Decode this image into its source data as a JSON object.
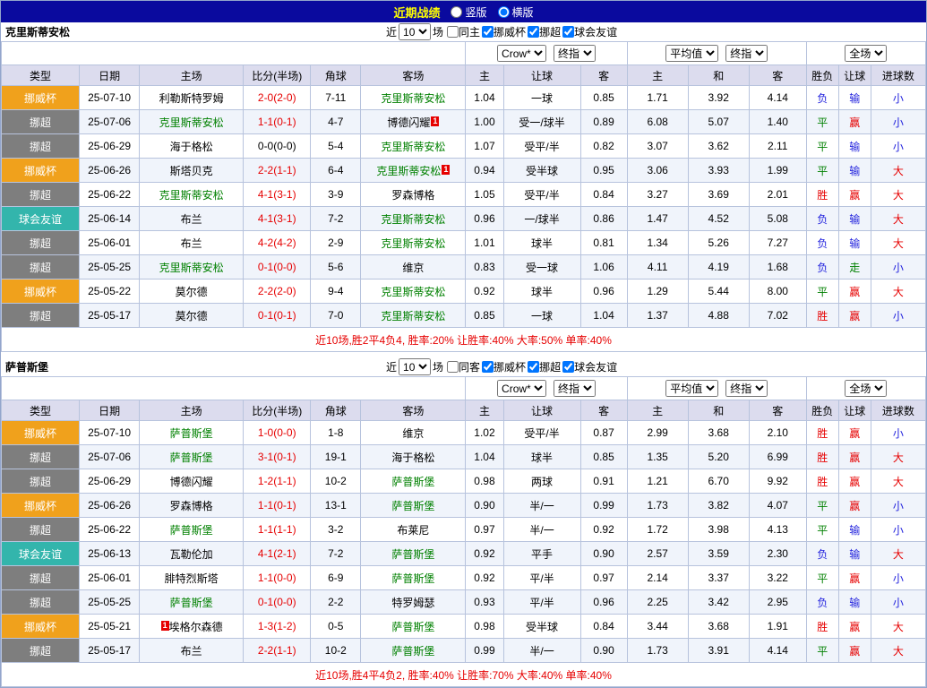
{
  "topbar": {
    "title": "近期战绩",
    "layout_options": [
      {
        "label": "竖版",
        "checked": false
      },
      {
        "label": "横版",
        "checked": true
      }
    ]
  },
  "colors": {
    "topbar_bg": "#0a0a9e",
    "title_color": "#ffff00",
    "header_bg": "#dcdcee",
    "type_bg": {
      "挪超": "#7e7e7e",
      "挪威杯": "#f0a11c",
      "球会友谊": "#33b5ac"
    },
    "result": {
      "胜": "#e60000",
      "平": "#008000",
      "负": "#2222dd",
      "赢": "#e60000",
      "输": "#2222dd",
      "走": "#008000",
      "大": "#e60000",
      "小": "#2222dd"
    },
    "team_highlight": "#008000",
    "score": "#e60000",
    "summary": "#e60000"
  },
  "table_columns": [
    "类型",
    "日期",
    "主场",
    "比分(半场)",
    "角球",
    "客场",
    "主",
    "让球",
    "客",
    "主",
    "和",
    "客",
    "胜负",
    "让球",
    "进球数"
  ],
  "sections": [
    {
      "team": "克里斯蒂安松",
      "range": {
        "prefix": "近",
        "count": "10",
        "suffix": "场"
      },
      "filters": [
        {
          "label": "同主",
          "checked": false
        },
        {
          "label": "挪威杯",
          "checked": true
        },
        {
          "label": "挪超",
          "checked": true
        },
        {
          "label": "球会友谊",
          "checked": true
        }
      ],
      "header_selects": {
        "asia": [
          "Crow*",
          "终指"
        ],
        "europe": [
          "平均值",
          "终指"
        ],
        "scope": [
          "全场"
        ]
      },
      "rows": [
        {
          "type": "挪威杯",
          "date": "25-07-10",
          "home": {
            "name": "利勒斯特罗姆"
          },
          "score": {
            "text": "2-0(2-0)",
            "red": true
          },
          "corner": "7-11",
          "away": {
            "name": "克里斯蒂安松",
            "green": true
          },
          "asia": [
            "1.04",
            "一球",
            "0.85"
          ],
          "europe": [
            "1.71",
            "3.92",
            "4.14"
          ],
          "result": [
            "负",
            "输",
            "小"
          ]
        },
        {
          "type": "挪超",
          "date": "25-07-06",
          "home": {
            "name": "克里斯蒂安松",
            "green": true
          },
          "score": {
            "text": "1-1(0-1)",
            "red": true
          },
          "corner": "4-7",
          "away": {
            "name": "博德闪耀",
            "badge": "1"
          },
          "asia": [
            "1.00",
            "受一/球半",
            "0.89"
          ],
          "europe": [
            "6.08",
            "5.07",
            "1.40"
          ],
          "result": [
            "平",
            "赢",
            "小"
          ]
        },
        {
          "type": "挪超",
          "date": "25-06-29",
          "home": {
            "name": "海于格松"
          },
          "score": {
            "text": "0-0(0-0)",
            "red": false
          },
          "corner": "5-4",
          "away": {
            "name": "克里斯蒂安松",
            "green": true
          },
          "asia": [
            "1.07",
            "受平/半",
            "0.82"
          ],
          "europe": [
            "3.07",
            "3.62",
            "2.11"
          ],
          "result": [
            "平",
            "输",
            "小"
          ]
        },
        {
          "type": "挪威杯",
          "date": "25-06-26",
          "home": {
            "name": "斯塔贝克"
          },
          "score": {
            "text": "2-2(1-1)",
            "red": true
          },
          "corner": "6-4",
          "away": {
            "name": "克里斯蒂安松",
            "green": true,
            "badge": "1"
          },
          "asia": [
            "0.94",
            "受半球",
            "0.95"
          ],
          "europe": [
            "3.06",
            "3.93",
            "1.99"
          ],
          "result": [
            "平",
            "输",
            "大"
          ]
        },
        {
          "type": "挪超",
          "date": "25-06-22",
          "home": {
            "name": "克里斯蒂安松",
            "green": true
          },
          "score": {
            "text": "4-1(3-1)",
            "red": true
          },
          "corner": "3-9",
          "away": {
            "name": "罗森博格"
          },
          "asia": [
            "1.05",
            "受平/半",
            "0.84"
          ],
          "europe": [
            "3.27",
            "3.69",
            "2.01"
          ],
          "result": [
            "胜",
            "赢",
            "大"
          ]
        },
        {
          "type": "球会友谊",
          "date": "25-06-14",
          "home": {
            "name": "布兰"
          },
          "score": {
            "text": "4-1(3-1)",
            "red": true
          },
          "corner": "7-2",
          "away": {
            "name": "克里斯蒂安松",
            "green": true
          },
          "asia": [
            "0.96",
            "一/球半",
            "0.86"
          ],
          "europe": [
            "1.47",
            "4.52",
            "5.08"
          ],
          "result": [
            "负",
            "输",
            "大"
          ]
        },
        {
          "type": "挪超",
          "date": "25-06-01",
          "home": {
            "name": "布兰"
          },
          "score": {
            "text": "4-2(4-2)",
            "red": true
          },
          "corner": "2-9",
          "away": {
            "name": "克里斯蒂安松",
            "green": true
          },
          "asia": [
            "1.01",
            "球半",
            "0.81"
          ],
          "europe": [
            "1.34",
            "5.26",
            "7.27"
          ],
          "result": [
            "负",
            "输",
            "大"
          ]
        },
        {
          "type": "挪超",
          "date": "25-05-25",
          "home": {
            "name": "克里斯蒂安松",
            "green": true
          },
          "score": {
            "text": "0-1(0-0)",
            "red": true
          },
          "corner": "5-6",
          "away": {
            "name": "维京"
          },
          "asia": [
            "0.83",
            "受一球",
            "1.06"
          ],
          "europe": [
            "4.11",
            "4.19",
            "1.68"
          ],
          "result": [
            "负",
            "走",
            "小"
          ]
        },
        {
          "type": "挪威杯",
          "date": "25-05-22",
          "home": {
            "name": "莫尔德"
          },
          "score": {
            "text": "2-2(2-0)",
            "red": true
          },
          "corner": "9-4",
          "away": {
            "name": "克里斯蒂安松",
            "green": true
          },
          "asia": [
            "0.92",
            "球半",
            "0.96"
          ],
          "europe": [
            "1.29",
            "5.44",
            "8.00"
          ],
          "result": [
            "平",
            "赢",
            "大"
          ]
        },
        {
          "type": "挪超",
          "date": "25-05-17",
          "home": {
            "name": "莫尔德"
          },
          "score": {
            "text": "0-1(0-1)",
            "red": true
          },
          "corner": "7-0",
          "away": {
            "name": "克里斯蒂安松",
            "green": true
          },
          "asia": [
            "0.85",
            "一球",
            "1.04"
          ],
          "europe": [
            "1.37",
            "4.88",
            "7.02"
          ],
          "result": [
            "胜",
            "赢",
            "小"
          ]
        }
      ],
      "summary": "近10场,胜2平4负4, 胜率:20% 让胜率:40% 大率:50% 单率:40%"
    },
    {
      "team": "萨普斯堡",
      "range": {
        "prefix": "近",
        "count": "10",
        "suffix": "场"
      },
      "filters": [
        {
          "label": "同客",
          "checked": false
        },
        {
          "label": "挪威杯",
          "checked": true
        },
        {
          "label": "挪超",
          "checked": true
        },
        {
          "label": "球会友谊",
          "checked": true
        }
      ],
      "header_selects": {
        "asia": [
          "Crow*",
          "终指"
        ],
        "europe": [
          "平均值",
          "终指"
        ],
        "scope": [
          "全场"
        ]
      },
      "rows": [
        {
          "type": "挪威杯",
          "date": "25-07-10",
          "home": {
            "name": "萨普斯堡",
            "green": true
          },
          "score": {
            "text": "1-0(0-0)",
            "red": true
          },
          "corner": "1-8",
          "away": {
            "name": "维京"
          },
          "asia": [
            "1.02",
            "受平/半",
            "0.87"
          ],
          "europe": [
            "2.99",
            "3.68",
            "2.10"
          ],
          "result": [
            "胜",
            "赢",
            "小"
          ]
        },
        {
          "type": "挪超",
          "date": "25-07-06",
          "home": {
            "name": "萨普斯堡",
            "green": true
          },
          "score": {
            "text": "3-1(0-1)",
            "red": true
          },
          "corner": "19-1",
          "away": {
            "name": "海于格松"
          },
          "asia": [
            "1.04",
            "球半",
            "0.85"
          ],
          "europe": [
            "1.35",
            "5.20",
            "6.99"
          ],
          "result": [
            "胜",
            "赢",
            "大"
          ]
        },
        {
          "type": "挪超",
          "date": "25-06-29",
          "home": {
            "name": "博德闪耀"
          },
          "score": {
            "text": "1-2(1-1)",
            "red": true
          },
          "corner": "10-2",
          "away": {
            "name": "萨普斯堡",
            "green": true
          },
          "asia": [
            "0.98",
            "两球",
            "0.91"
          ],
          "europe": [
            "1.21",
            "6.70",
            "9.92"
          ],
          "result": [
            "胜",
            "赢",
            "大"
          ]
        },
        {
          "type": "挪威杯",
          "date": "25-06-26",
          "home": {
            "name": "罗森博格"
          },
          "score": {
            "text": "1-1(0-1)",
            "red": true
          },
          "corner": "13-1",
          "away": {
            "name": "萨普斯堡",
            "green": true
          },
          "asia": [
            "0.90",
            "半/一",
            "0.99"
          ],
          "europe": [
            "1.73",
            "3.82",
            "4.07"
          ],
          "result": [
            "平",
            "赢",
            "小"
          ]
        },
        {
          "type": "挪超",
          "date": "25-06-22",
          "home": {
            "name": "萨普斯堡",
            "green": true
          },
          "score": {
            "text": "1-1(1-1)",
            "red": true
          },
          "corner": "3-2",
          "away": {
            "name": "布莱尼"
          },
          "asia": [
            "0.97",
            "半/一",
            "0.92"
          ],
          "europe": [
            "1.72",
            "3.98",
            "4.13"
          ],
          "result": [
            "平",
            "输",
            "小"
          ]
        },
        {
          "type": "球会友谊",
          "date": "25-06-13",
          "home": {
            "name": "瓦勒伦加"
          },
          "score": {
            "text": "4-1(2-1)",
            "red": true
          },
          "corner": "7-2",
          "away": {
            "name": "萨普斯堡",
            "green": true
          },
          "asia": [
            "0.92",
            "平手",
            "0.90"
          ],
          "europe": [
            "2.57",
            "3.59",
            "2.30"
          ],
          "result": [
            "负",
            "输",
            "大"
          ]
        },
        {
          "type": "挪超",
          "date": "25-06-01",
          "home": {
            "name": "腓特烈斯塔"
          },
          "score": {
            "text": "1-1(0-0)",
            "red": true
          },
          "corner": "6-9",
          "away": {
            "name": "萨普斯堡",
            "green": true
          },
          "asia": [
            "0.92",
            "平/半",
            "0.97"
          ],
          "europe": [
            "2.14",
            "3.37",
            "3.22"
          ],
          "result": [
            "平",
            "赢",
            "小"
          ]
        },
        {
          "type": "挪超",
          "date": "25-05-25",
          "home": {
            "name": "萨普斯堡",
            "green": true
          },
          "score": {
            "text": "0-1(0-0)",
            "red": true
          },
          "corner": "2-2",
          "away": {
            "name": "特罗姆瑟"
          },
          "asia": [
            "0.93",
            "平/半",
            "0.96"
          ],
          "europe": [
            "2.25",
            "3.42",
            "2.95"
          ],
          "result": [
            "负",
            "输",
            "小"
          ]
        },
        {
          "type": "挪威杯",
          "date": "25-05-21",
          "home": {
            "name": "埃格尔森德",
            "badge": "1",
            "badge_before": true
          },
          "score": {
            "text": "1-3(1-2)",
            "red": true
          },
          "corner": "0-5",
          "away": {
            "name": "萨普斯堡",
            "green": true
          },
          "asia": [
            "0.98",
            "受半球",
            "0.84"
          ],
          "europe": [
            "3.44",
            "3.68",
            "1.91"
          ],
          "result": [
            "胜",
            "赢",
            "大"
          ]
        },
        {
          "type": "挪超",
          "date": "25-05-17",
          "home": {
            "name": "布兰"
          },
          "score": {
            "text": "2-2(1-1)",
            "red": true
          },
          "corner": "10-2",
          "away": {
            "name": "萨普斯堡",
            "green": true
          },
          "asia": [
            "0.99",
            "半/一",
            "0.90"
          ],
          "europe": [
            "1.73",
            "3.91",
            "4.14"
          ],
          "result": [
            "平",
            "赢",
            "大"
          ]
        }
      ],
      "summary": "近10场,胜4平4负2, 胜率:40% 让胜率:70% 大率:40% 单率:40%"
    }
  ]
}
